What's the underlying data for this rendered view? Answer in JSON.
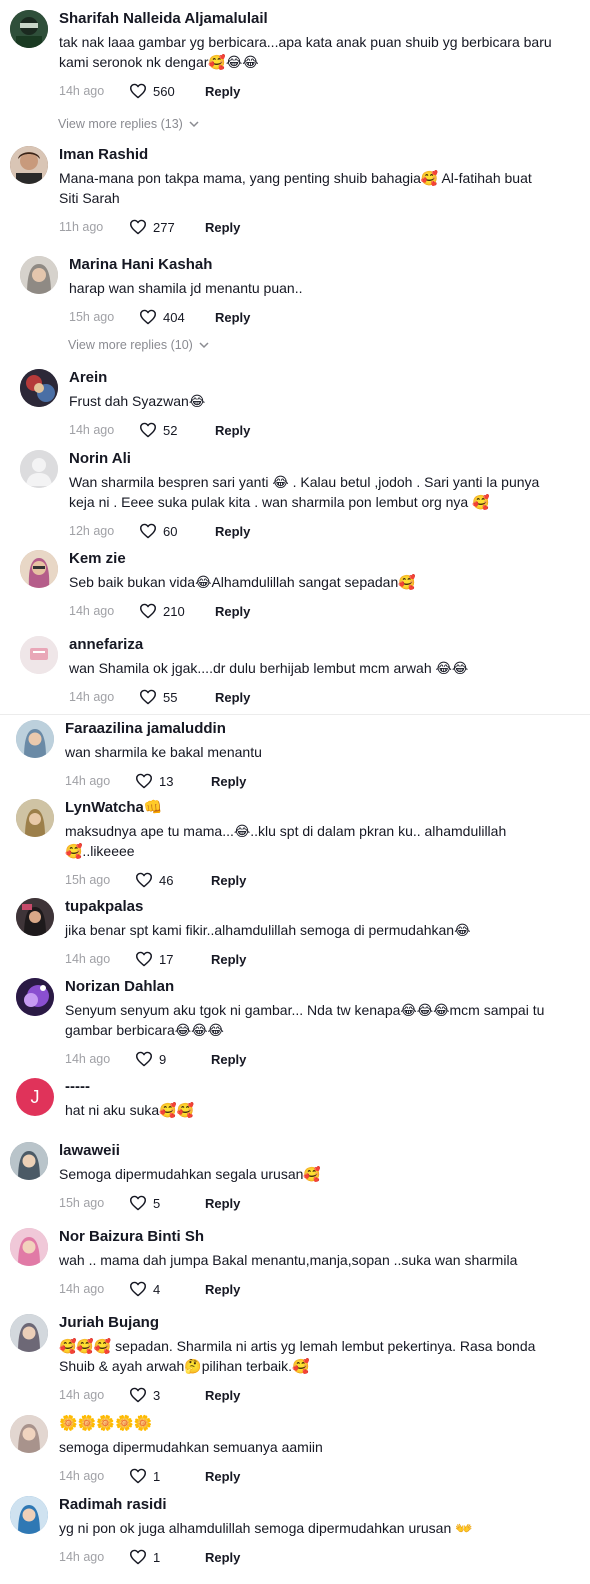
{
  "comments": [
    {
      "username": "Sharifah Nalleida Aljamalulail",
      "lines": [
        "tak nak laaa gambar yg berbicara...apa kata anak puan shuib yg berbicara baru",
        "kami seronok nk dengar🥰😂😂"
      ],
      "time": "14h ago",
      "likes": "560",
      "reply": "Reply",
      "avatar_color": "#2b3a2e"
    },
    {
      "username": "Iman Rashid",
      "lines": [
        "Mana-mana pon takpa mama, yang penting shuib bahagia🥰 Al-fatihah buat",
        "Siti Sarah"
      ],
      "time": "11h ago",
      "likes": "277",
      "reply": "Reply",
      "avatar_color": "#7a5a46"
    },
    {
      "username": "Marina Hani Kashah",
      "lines": [
        "harap wan shamila jd menantu puan.."
      ],
      "time": "15h ago",
      "likes": "404",
      "reply": "Reply",
      "avatar_color": "#b6b0a8"
    },
    {
      "username": "Arein",
      "lines": [
        "Frust dah Syazwan😂"
      ],
      "time": "14h ago",
      "likes": "52",
      "reply": "Reply",
      "avatar_color": "#3a3442"
    },
    {
      "username": "Norin Ali",
      "lines": [
        "Wan sharmila bespren sari yanti 😂 . Kalau betul ,jodoh . Sari yanti la punya",
        "keja ni . Eeee suka pulak kita . wan sharmila pon lembut org nya 🥰"
      ],
      "time": "12h ago",
      "likes": "60",
      "reply": "Reply",
      "avatar_color": "#d9d9db"
    },
    {
      "username": "Kem zie",
      "lines": [
        "Seb baik bukan vida😂Alhamdulillah sangat sepadan🥰"
      ],
      "time": "14h ago",
      "likes": "210",
      "reply": "Reply",
      "avatar_color": "#c9a48a"
    },
    {
      "username": "annefariza",
      "lines": [
        "wan Shamila ok jgak....dr dulu berhijab lembut mcm arwah 😂😂"
      ],
      "time": "14h ago",
      "likes": "55",
      "reply": "Reply",
      "avatar_color": "#e8d9dc"
    },
    {
      "username": "Faraazilina jamaluddin",
      "lines": [
        "wan sharmila ke bakal menantu"
      ],
      "time": "14h ago",
      "likes": "13",
      "reply": "Reply",
      "avatar_color": "#9fb4c4"
    },
    {
      "username": "LynWatcha👊",
      "lines": [
        "maksudnya ape tu mama...😂..klu spt di dalam pkran ku.. alhamdulillah",
        "🥰..likeeee"
      ],
      "time": "15h ago",
      "likes": "46",
      "reply": "Reply",
      "avatar_color": "#a89a7a"
    },
    {
      "username": "tupakpalas",
      "lines": [
        "jika benar spt kami fikir..alhamdulillah semoga di permudahkan😂"
      ],
      "time": "14h ago",
      "likes": "17",
      "reply": "Reply",
      "avatar_color": "#5a4a52"
    },
    {
      "username": "Norizan Dahlan",
      "lines": [
        "Senyum senyum aku tgok ni gambar... Nda tw kenapa😂😂😂mcm sampai tu",
        "gambar berbicara😂😂😂"
      ],
      "time": "14h ago",
      "likes": "9",
      "reply": "Reply",
      "avatar_color": "#6b3fa0"
    },
    {
      "username": "-----",
      "lines": [
        "hat ni aku suka🥰🥰"
      ],
      "time": "",
      "likes": "",
      "reply": "",
      "avatar_color": "#e0335a",
      "avatar_letter": "J"
    },
    {
      "username": "lawaweii",
      "lines": [
        "Semoga dipermudahkan segala urusan🥰"
      ],
      "time": "15h ago",
      "likes": "5",
      "reply": "Reply",
      "avatar_color": "#7c8c96"
    },
    {
      "username": "Nor Baizura Binti Sh",
      "lines": [
        "wah .. mama dah jumpa Bakal menantu,manja,sopan ..suka wan sharmila"
      ],
      "time": "14h ago",
      "likes": "4",
      "reply": "Reply",
      "avatar_color": "#d7a3b7"
    },
    {
      "username": "Juriah Bujang",
      "lines": [
        "🥰🥰🥰 sepadan. Sharmila ni artis yg lemah lembut pekertinya. Rasa bonda",
        "Shuib & ayah arwah🤔pilihan terbaik.🥰"
      ],
      "time": "14h ago",
      "likes": "3",
      "reply": "Reply",
      "avatar_color": "#8e9aa6"
    },
    {
      "username": "🌼🌼🌼🌼🌼",
      "lines": [
        "semoga dipermudahkan semuanya aamiin"
      ],
      "time": "14h ago",
      "likes": "1",
      "reply": "Reply",
      "avatar_color": "#c8b6b0"
    },
    {
      "username": "Radimah rasidi",
      "lines": [
        "yg ni pon ok juga alhamdulillah semoga dipermudahkan urusan 👐"
      ],
      "time": "14h ago",
      "likes": "1",
      "reply": "Reply",
      "avatar_color": "#4f8fbf"
    }
  ],
  "view_more": [
    {
      "label": "View more replies (13)"
    },
    {
      "label": "View more replies (10)"
    }
  ]
}
